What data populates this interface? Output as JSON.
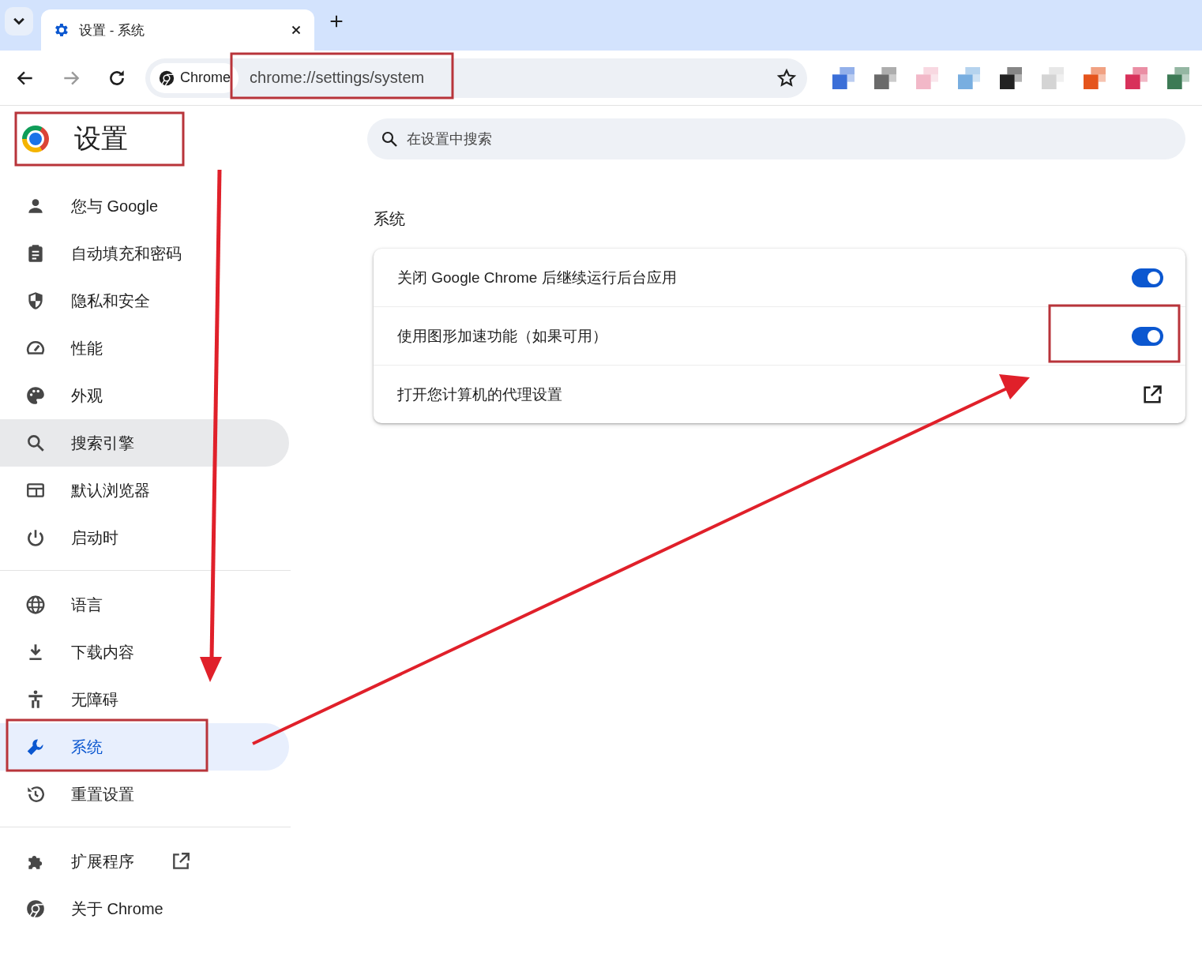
{
  "tab_strip": {
    "tabs": [
      {
        "title": "设置 - 系统",
        "selected": true
      }
    ]
  },
  "toolbar": {
    "site_chip": "Chrome",
    "url": "chrome://settings/system",
    "extensions": [
      {
        "color": "#3b6fd8"
      },
      {
        "color": "#6a6a6a"
      },
      {
        "color": "#f2b8c8"
      },
      {
        "color": "#78aee0"
      },
      {
        "color": "#222222"
      },
      {
        "color": "#d4d4d4"
      },
      {
        "color": "#e5541c"
      },
      {
        "color": "#d8315a"
      },
      {
        "color": "#3d7a55"
      }
    ]
  },
  "sidebar": {
    "title": "设置",
    "groups": [
      [
        {
          "label": "您与 Google",
          "selected": false,
          "hovered": false,
          "external": false
        },
        {
          "label": "自动填充和密码",
          "selected": false,
          "hovered": false,
          "external": false
        },
        {
          "label": "隐私和安全",
          "selected": false,
          "hovered": false,
          "external": false
        },
        {
          "label": "性能",
          "selected": false,
          "hovered": false,
          "external": false
        },
        {
          "label": "外观",
          "selected": false,
          "hovered": false,
          "external": false
        },
        {
          "label": "搜索引擎",
          "selected": false,
          "hovered": true,
          "external": false
        },
        {
          "label": "默认浏览器",
          "selected": false,
          "hovered": false,
          "external": false
        },
        {
          "label": "启动时",
          "selected": false,
          "hovered": false,
          "external": false
        }
      ],
      [
        {
          "label": "语言",
          "selected": false,
          "hovered": false,
          "external": false
        },
        {
          "label": "下载内容",
          "selected": false,
          "hovered": false,
          "external": false
        },
        {
          "label": "无障碍",
          "selected": false,
          "hovered": false,
          "external": false
        },
        {
          "label": "系统",
          "selected": true,
          "hovered": false,
          "external": false
        },
        {
          "label": "重置设置",
          "selected": false,
          "hovered": false,
          "external": false
        }
      ],
      [
        {
          "label": "扩展程序",
          "selected": false,
          "hovered": false,
          "external": true
        },
        {
          "label": "关于 Chrome",
          "selected": false,
          "hovered": false,
          "external": false
        }
      ]
    ]
  },
  "search": {
    "placeholder": "在设置中搜索"
  },
  "section": {
    "title": "系统",
    "rows": [
      {
        "kind": "toggle",
        "label": "关闭 Google Chrome 后继续运行后台应用",
        "on": true
      },
      {
        "kind": "toggle",
        "label": "使用图形加速功能（如果可用）",
        "on": true
      },
      {
        "kind": "link",
        "label": "打开您计算机的代理设置"
      }
    ]
  }
}
